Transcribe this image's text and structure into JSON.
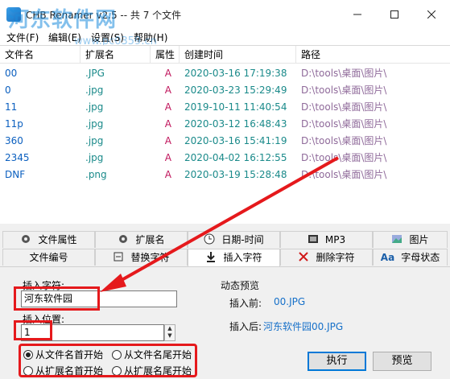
{
  "window": {
    "title": "CHB Renamer v2.5 -- 共 7 个文件",
    "watermark": "河东软件网",
    "watermark_sub": "www.pc0359.cn"
  },
  "menu": [
    "文件(F)",
    "编辑(E)",
    "设置(S)",
    "帮助(H)"
  ],
  "columns": [
    "文件名",
    "扩展名",
    "属性",
    "创建时间",
    "路径"
  ],
  "files": [
    {
      "name": "00",
      "ext": ".JPG",
      "attr": "A",
      "time": "2020-03-16 17:19:38",
      "path": "D:\\tools\\桌面\\图片\\"
    },
    {
      "name": "0",
      "ext": ".jpg",
      "attr": "A",
      "time": "2020-03-23 15:29:49",
      "path": "D:\\tools\\桌面\\图片\\"
    },
    {
      "name": "11",
      "ext": ".jpg",
      "attr": "A",
      "time": "2019-10-11 11:40:54",
      "path": "D:\\tools\\桌面\\图片\\"
    },
    {
      "name": "11p",
      "ext": ".jpg",
      "attr": "A",
      "time": "2020-03-12 16:48:43",
      "path": "D:\\tools\\桌面\\图片\\"
    },
    {
      "name": "360",
      "ext": ".jpg",
      "attr": "A",
      "time": "2020-03-16 15:41:19",
      "path": "D:\\tools\\桌面\\图片\\"
    },
    {
      "name": "2345",
      "ext": ".jpg",
      "attr": "A",
      "time": "2020-04-02 16:12:55",
      "path": "D:\\tools\\桌面\\图片\\"
    },
    {
      "name": "DNF",
      "ext": ".png",
      "attr": "A",
      "time": "2020-03-19 15:28:48",
      "path": "D:\\tools\\桌面\\图片\\"
    }
  ],
  "tabs_row1": [
    "文件属性",
    "扩展名",
    "日期-时间",
    "MP3",
    "图片"
  ],
  "tabs_row2": [
    "文件编号",
    "替换字符",
    "插入字符",
    "删除字符",
    "字母状态"
  ],
  "active_tab": "插入字符",
  "insert": {
    "text_label": "插入字符:",
    "text_value": "河东软件园",
    "position_label": "插入位置:",
    "position_value": "1",
    "options": [
      "从文件名首开始",
      "从文件名尾开始",
      "从扩展名首开始",
      "从扩展名尾开始"
    ],
    "selected_option": "从文件名首开始"
  },
  "preview": {
    "title": "动态预览",
    "before_label": "插入前:",
    "before_value": "00.JPG",
    "after_label": "插入后:",
    "after_value": "河东软件园00.JPG"
  },
  "buttons": {
    "execute": "执行",
    "preview": "预览"
  },
  "colors": {
    "accent": "#0078d7",
    "highlight": "#e5191c",
    "link": "#1670c9"
  }
}
